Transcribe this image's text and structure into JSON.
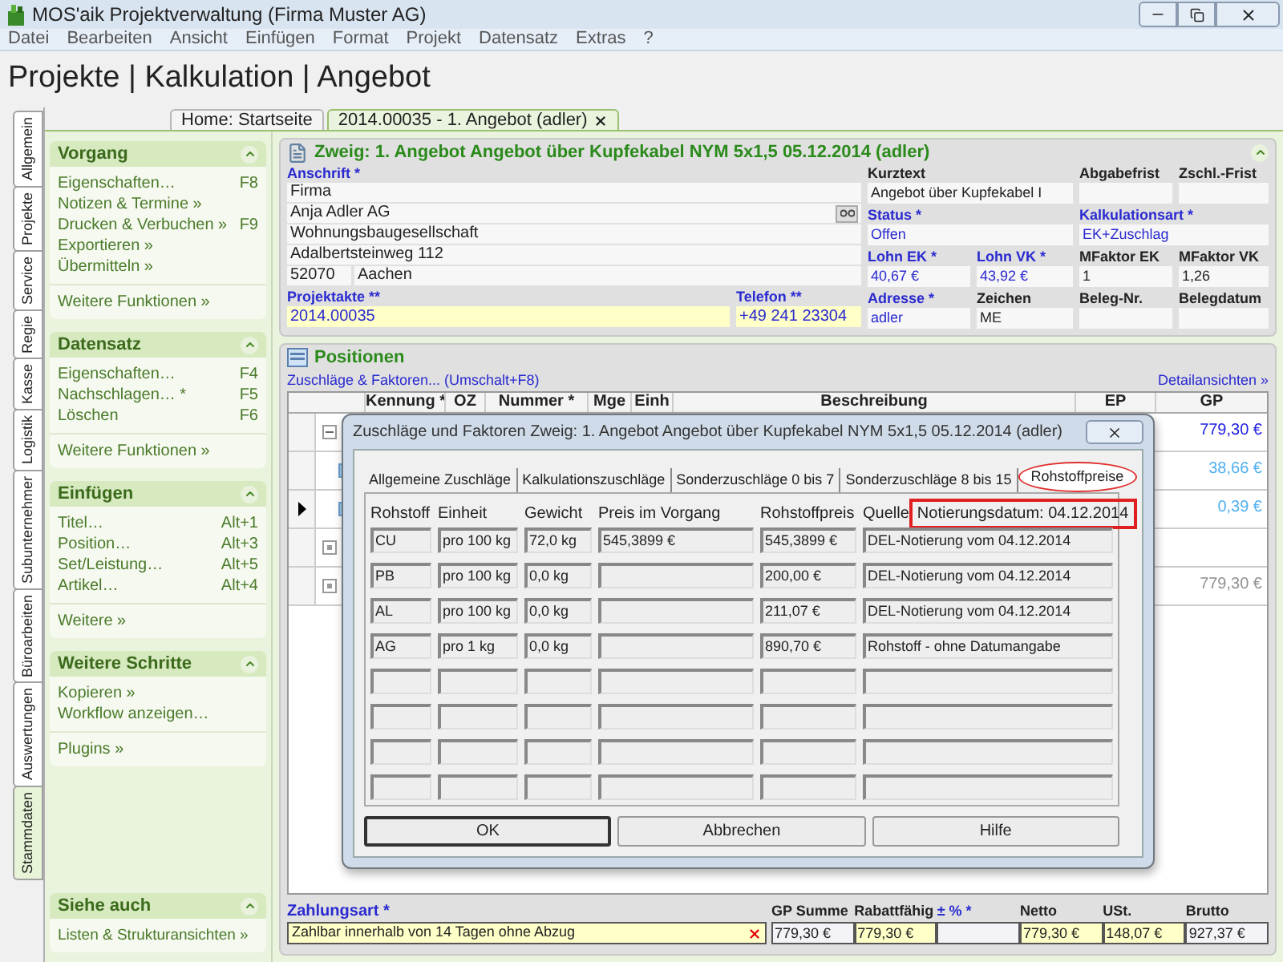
{
  "window": {
    "title": "MOS'aik Projektverwaltung (Firma Muster AG)"
  },
  "menu": [
    "Datei",
    "Bearbeiten",
    "Ansicht",
    "Einfügen",
    "Format",
    "Projekt",
    "Datensatz",
    "Extras",
    "?"
  ],
  "heading": "Projekte | Kalkulation | Angebot",
  "side_tabs": [
    {
      "label": "Allgemein",
      "selected": false
    },
    {
      "label": "Projekte",
      "selected": false
    },
    {
      "label": "Service",
      "selected": false
    },
    {
      "label": "Regie",
      "selected": false
    },
    {
      "label": "Kasse",
      "selected": false
    },
    {
      "label": "Logistik",
      "selected": false
    },
    {
      "label": "Subunternehmer",
      "selected": false
    },
    {
      "label": "Büroarbeiten",
      "selected": false
    },
    {
      "label": "Auswertungen",
      "selected": false
    },
    {
      "label": "Stammdaten",
      "selected": true
    }
  ],
  "doc_tabs": [
    {
      "label": "Home: Startseite",
      "selected": false,
      "closable": false
    },
    {
      "label": "2014.00035 - 1. Angebot (adler)",
      "selected": true,
      "closable": true
    }
  ],
  "task_groups": [
    {
      "title": "Vorgang",
      "items": [
        {
          "label": "Eigenschaften…",
          "shortcut": "F8"
        },
        {
          "label": "Notizen & Termine »"
        },
        {
          "label": "Drucken & Verbuchen »",
          "shortcut": "F9"
        },
        {
          "label": "Exportieren »"
        },
        {
          "label": "Übermitteln »"
        }
      ],
      "more": [
        "Weitere Funktionen »"
      ]
    },
    {
      "title": "Datensatz",
      "items": [
        {
          "label": "Eigenschaften…",
          "shortcut": "F4"
        },
        {
          "label": "Nachschlagen… *",
          "shortcut": "F5"
        },
        {
          "label": "Löschen",
          "shortcut": "F6"
        }
      ],
      "more": [
        "Weitere Funktionen »"
      ]
    },
    {
      "title": "Einfügen",
      "items": [
        {
          "label": "Titel…",
          "shortcut": "Alt+1"
        },
        {
          "label": "Position…",
          "shortcut": "Alt+3"
        },
        {
          "label": "Set/Leistung…",
          "shortcut": "Alt+5"
        },
        {
          "label": "Artikel…",
          "shortcut": "Alt+4"
        }
      ],
      "more": [
        "Weitere »"
      ]
    },
    {
      "title": "Weitere Schritte",
      "items": [
        {
          "label": "Kopieren »"
        },
        {
          "label": "Workflow anzeigen…"
        }
      ],
      "more": [
        "Plugins »"
      ]
    }
  ],
  "see_also": {
    "title": "Siehe auch",
    "items": [
      "Listen & Strukturansichten »"
    ]
  },
  "zweig": {
    "title": "Zweig: 1. Angebot Angebot über Kupfekabel NYM 5x1,5 05.12.2014 (adler)",
    "address": {
      "label": "Anschrift *",
      "link": true,
      "lines": [
        {
          "text": "Firma",
          "lookup": false
        },
        {
          "text": "Anja Adler AG",
          "lookup": true
        },
        {
          "text": "Wohnungsbaugesellschaft",
          "lookup": false
        },
        {
          "text": "Adalbertsteinweg 112",
          "lookup": false
        }
      ],
      "postcode": "52070",
      "city": "Aachen"
    },
    "lower": [
      {
        "label": "Projektakte **",
        "value": "2014.00035",
        "link": true,
        "highlight": true
      },
      {
        "label": "Telefon **",
        "value": "+49 241 23304",
        "link": true,
        "highlight": true
      }
    ],
    "grid": [
      [
        {
          "label": "Kurztext",
          "value": "Angebot über Kupfekabel I",
          "link": false,
          "highlight": false
        },
        {
          "label": "Abgabefrist",
          "link": false,
          "highlight": false
        },
        {
          "label": "Zschl.-Frist",
          "link": false,
          "highlight": false
        }
      ],
      [
        {
          "label": "Status *",
          "value": "Offen",
          "link": true,
          "highlight": false
        },
        {
          "label": "Kalkulationsart *",
          "value": "EK+Zuschlag",
          "link": true,
          "highlight": false
        }
      ],
      [
        {
          "label": "Lohn EK *",
          "value": "40,67 €",
          "link": true,
          "highlight": false
        },
        {
          "label": "Lohn VK *",
          "value": "43,92 €",
          "link": true,
          "highlight": false
        },
        {
          "label": "MFaktor EK",
          "value": "1",
          "link": false,
          "highlight": false
        },
        {
          "label": "MFaktor VK",
          "value": "1,26",
          "link": false,
          "highlight": false
        }
      ],
      [
        {
          "label": "Adresse *",
          "value": "adler",
          "link": true,
          "highlight": false
        },
        {
          "label": "Zeichen",
          "value": "ME",
          "link": false,
          "highlight": false
        },
        {
          "label": "Beleg-Nr.",
          "link": false,
          "highlight": false
        },
        {
          "label": "Belegdatum",
          "link": false,
          "highlight": false
        }
      ]
    ]
  },
  "positions": {
    "title": "Positionen",
    "link": "Zuschläge & Faktoren... (Umschalt+F8)",
    "details": "Detailansichten »",
    "columns": [
      "Kennung *",
      "OZ",
      "Nummer *",
      "Mge",
      "Einh",
      "Beschreibung",
      "EP",
      "GP"
    ],
    "rows": [
      {
        "kind": "expanded",
        "current": false,
        "gp": "779,30 €",
        "color": "#2020e0"
      },
      {
        "kind": "item",
        "current": false,
        "gp": "38,66 €",
        "color": "#50b0f0"
      },
      {
        "kind": "item",
        "current": true,
        "gp": "0,39 €",
        "color": "#50b0f0"
      },
      {
        "kind": "collapsed",
        "current": false
      },
      {
        "kind": "collapsed",
        "current": false,
        "gp": "779,30 €",
        "color": "#909090"
      }
    ]
  },
  "dialog": {
    "title": "Zuschläge und Faktoren Zweig: 1. Angebot Angebot über Kupfekabel NYM 5x1,5 05.12.2014 (adler)",
    "tabs": [
      {
        "label": "Allgemeine Zuschläge",
        "selected": false,
        "circled": false
      },
      {
        "label": "Kalkulationszuschläge",
        "selected": false,
        "circled": false
      },
      {
        "label": "Sonderzuschläge 0 bis 7",
        "selected": false,
        "circled": false
      },
      {
        "label": "Sonderzuschläge 8 bis 15",
        "selected": false,
        "circled": false
      },
      {
        "label": "Rohstoffpreise",
        "selected": true,
        "circled": true
      }
    ],
    "columns": [
      "Rohstoff",
      "Einheit",
      "Gewicht",
      "Preis im Vorgang",
      "Rohstoffpreis",
      "Quelle"
    ],
    "note": {
      "text": "Notierungsdatum: 04.12.2014",
      "boxed": true
    },
    "rows": [
      [
        "CU",
        "pro 100 kg",
        "72,0 kg",
        "545,3899 €",
        "545,3899 €",
        "DEL-Notierung vom 04.12.2014"
      ],
      [
        "PB",
        "pro 100 kg",
        "0,0 kg",
        null,
        "200,00 €",
        "DEL-Notierung vom 04.12.2014"
      ],
      [
        "AL",
        "pro 100 kg",
        "0,0 kg",
        null,
        "211,07 €",
        "DEL-Notierung vom 04.12.2014"
      ],
      [
        "AG",
        "pro 1 kg",
        "0,0 kg",
        null,
        "890,70 €",
        "Rohstoff - ohne Datumangabe"
      ]
    ],
    "buttons": [
      {
        "label": "OK",
        "default": true
      },
      {
        "label": "Abbrechen",
        "default": false
      },
      {
        "label": "Hilfe",
        "default": false
      }
    ]
  },
  "footer": {
    "payment": {
      "label": "Zahlungsart *",
      "value": "Zahlbar innerhalb von 14 Tagen ohne Abzug"
    },
    "totals": [
      {
        "label": "GP Summe",
        "value": "779,30 €",
        "link": false,
        "highlight": false
      },
      {
        "label": "Rabattfähig",
        "value": "779,30 €",
        "link": false,
        "highlight": true
      },
      {
        "label": "± % *",
        "link": true,
        "highlight": false
      },
      {
        "label": "Netto",
        "value": "779,30 €",
        "link": false,
        "highlight": true
      },
      {
        "label": "USt.",
        "value": "148,07 €",
        "link": false,
        "highlight": true
      },
      {
        "label": "Brutto",
        "value": "927,37 €",
        "link": false,
        "highlight": false
      }
    ]
  }
}
